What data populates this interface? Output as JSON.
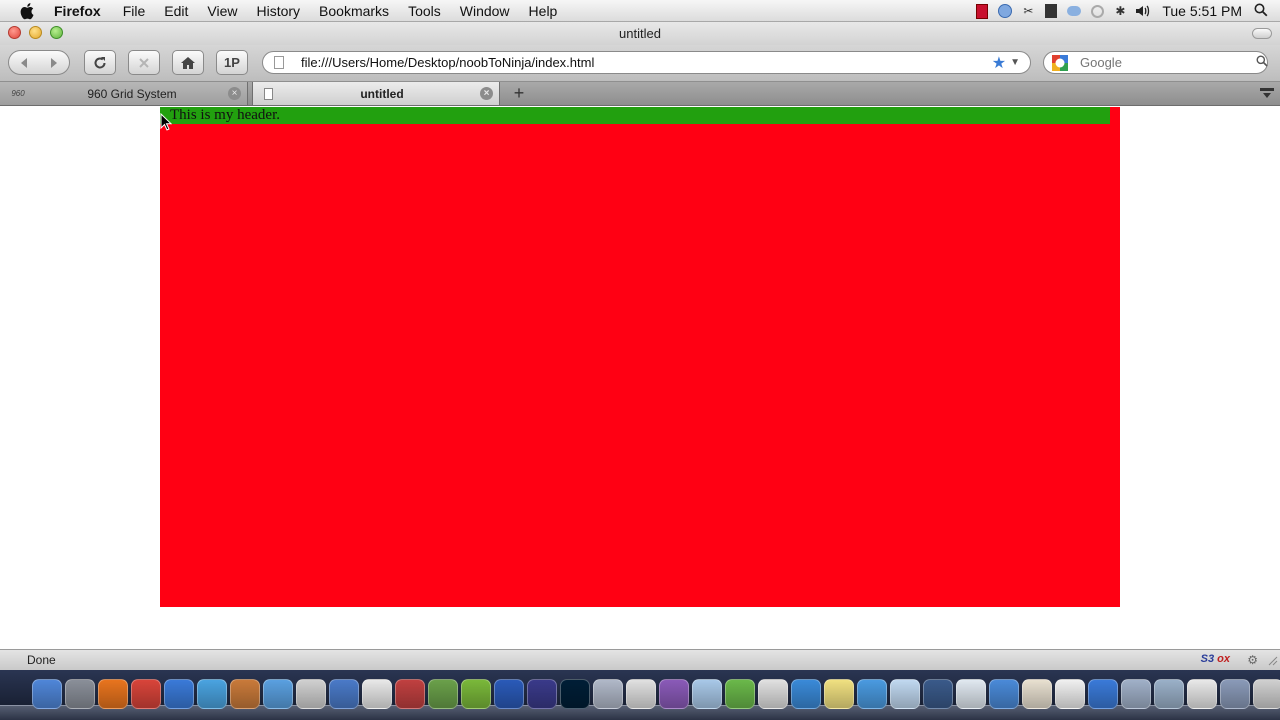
{
  "menubar": {
    "app_name": "Firefox",
    "menus": [
      "File",
      "Edit",
      "View",
      "History",
      "Bookmarks",
      "Tools",
      "Window",
      "Help"
    ],
    "clock": "Tue 5:51 PM"
  },
  "window": {
    "title": "untitled"
  },
  "toolbar": {
    "onepassword_label": "1P",
    "url": "file:///Users/Home/Desktop/noobToNinja/index.html",
    "search_placeholder": "Google"
  },
  "tabs": [
    {
      "label": "960 Grid System",
      "favicon_text": "960",
      "active": false
    },
    {
      "label": "untitled",
      "active": true
    }
  ],
  "page": {
    "header_text": "This is my header.",
    "container_color": "#ff0013",
    "header_color": "#22a00f"
  },
  "statusbar": {
    "status": "Done",
    "addon_label_a": "S3",
    "addon_label_b": "ox"
  },
  "dock": {
    "icon_colors": [
      "#4f86d8",
      "#8a8f99",
      "#e8741e",
      "#d8443a",
      "#3a7ad8",
      "#4aa3e0",
      "#c97a3a",
      "#5aa0e0",
      "#d0d0d0",
      "#4a7ac8",
      "#e8e8e8",
      "#c04040",
      "#6aa04a",
      "#7ab83a",
      "#2a5ab8",
      "#3a3a8a",
      "#001e36",
      "#b0b8c8",
      "#e0e0e0",
      "#8a5ab8",
      "#a8c8e8",
      "#6ab84a",
      "#e0e0e0",
      "#3a8ad8",
      "#f0e080",
      "#4a9ae0",
      "#c0d8f0",
      "#3a5a8a",
      "#e0e8f0",
      "#4a8ad8",
      "#e8e0d0",
      "#f0f0f0",
      "#3a7ad8",
      "#a0b0c8",
      "#9ab0c8",
      "#e8e8e8",
      "#8a9ab8",
      "#d0d0d0"
    ]
  }
}
